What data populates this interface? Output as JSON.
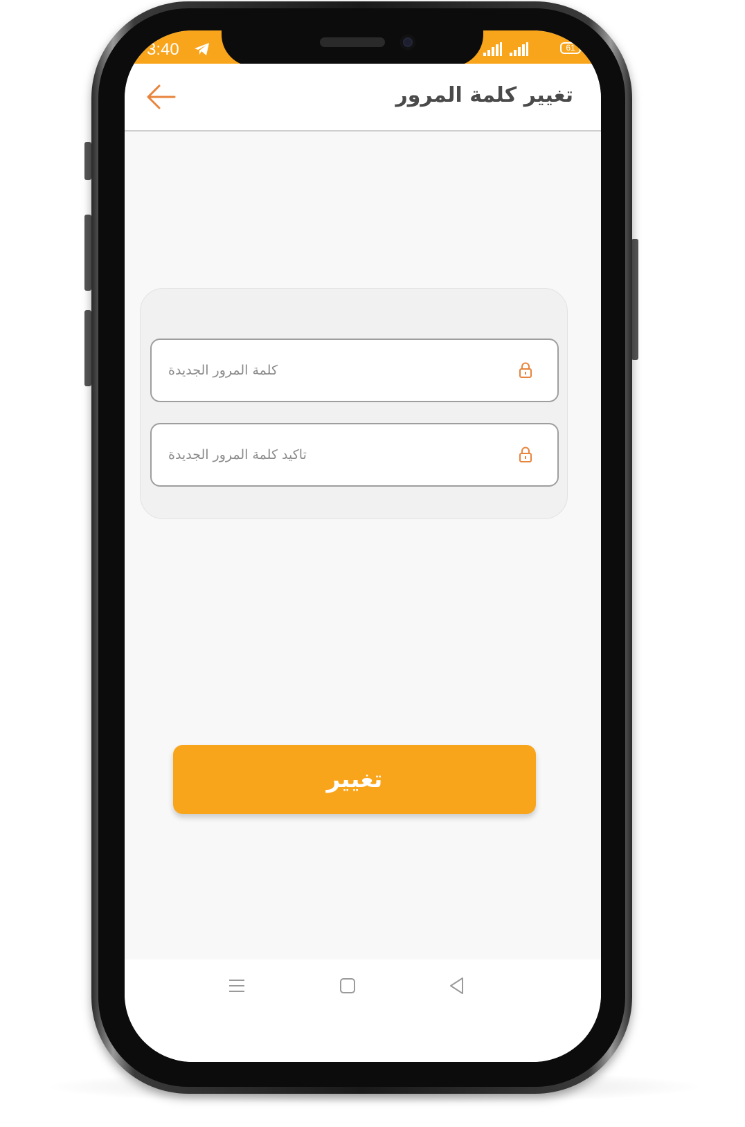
{
  "status_bar": {
    "time": "3:40",
    "battery": "61",
    "background_color": "#f9a51b",
    "icons": [
      "telegram-icon",
      "signal-icon",
      "signal-icon",
      "battery-icon"
    ]
  },
  "app_bar": {
    "title": "تغيير كلمة المرور",
    "back_icon": "arrow-left-icon",
    "accent_color": "#e8843c"
  },
  "form": {
    "new_password": {
      "placeholder": "كلمة المرور الجديدة",
      "icon": "lock-icon"
    },
    "confirm_password": {
      "placeholder": "تاكيد كلمة المرور الجديدة",
      "icon": "lock-icon"
    }
  },
  "submit_button": {
    "label": "تغيير",
    "color": "#f9a51b"
  },
  "nav_bar": {
    "items": [
      "menu-icon",
      "home-square-icon",
      "back-triangle-icon"
    ]
  }
}
